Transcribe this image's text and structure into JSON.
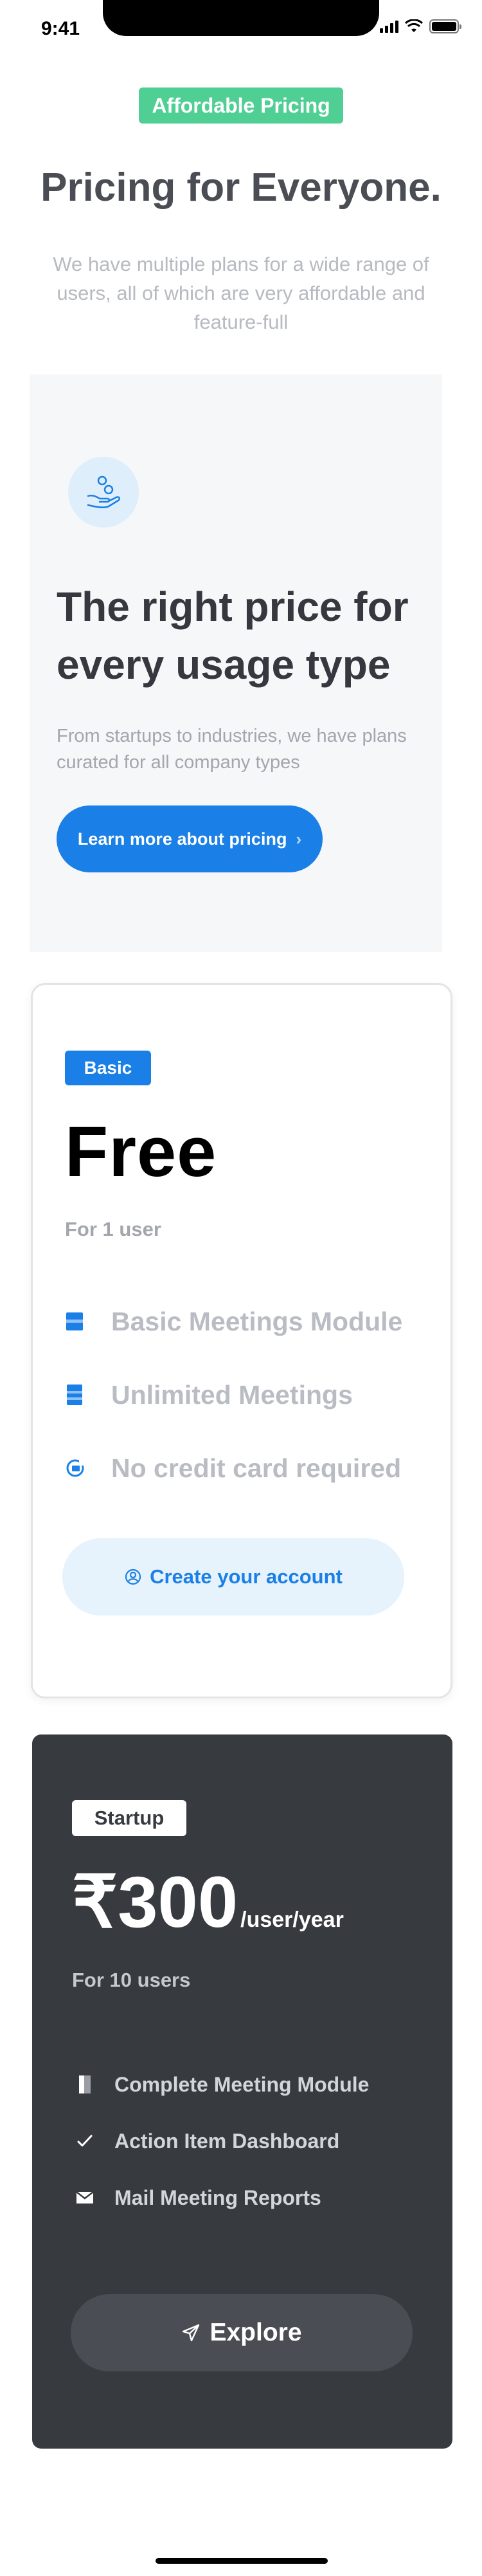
{
  "status_bar": {
    "time": "9:41"
  },
  "hero": {
    "badge": "Affordable Pricing",
    "title": "Pricing for Everyone.",
    "subtitle": "We have multiple plans for a wide range of users, all of which are very affordable and feature-full"
  },
  "intro": {
    "icon": "hand-with-coins-icon",
    "title": "The right price for every usage type",
    "description": "From startups to industries, we have plans curated for all company types",
    "button_label": "Learn more about pricing"
  },
  "plans": {
    "basic": {
      "badge": "Basic",
      "price": "Free",
      "users": "For 1 user",
      "features": [
        {
          "icon": "module-icon",
          "label": "Basic Meetings Module"
        },
        {
          "icon": "meetings-icon",
          "label": "Unlimited Meetings"
        },
        {
          "icon": "card-icon",
          "label": "No credit card required"
        }
      ],
      "cta_icon": "user-circle-icon",
      "cta_label": "Create your account"
    },
    "startup": {
      "badge": "Startup",
      "price": "₹300",
      "price_unit": "/user/year",
      "users": "For 10 users",
      "features": [
        {
          "icon": "door-icon",
          "label": "Complete Meeting Module"
        },
        {
          "icon": "check-icon",
          "label": "Action Item Dashboard"
        },
        {
          "icon": "mail-icon",
          "label": "Mail Meeting Reports"
        }
      ],
      "cta_icon": "send-icon",
      "cta_label": "Explore"
    }
  },
  "colors": {
    "accent_blue": "#1a7fe6",
    "badge_green": "#4fcf93",
    "dark_card": "#373a3f"
  }
}
